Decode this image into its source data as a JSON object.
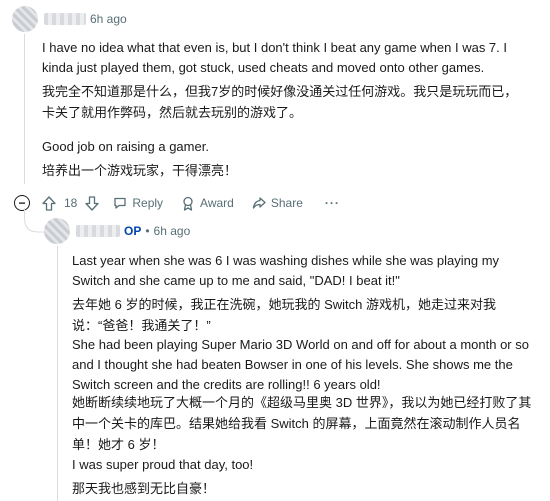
{
  "comment1": {
    "time": "6h ago",
    "en_paragraph1": "I have no idea what that even is, but I don't think I beat any game when I was 7. I kinda just played them, got stuck, used cheats and moved onto other games.",
    "zh_paragraph1": "我完全不知道那是什么，但我7岁的时候好像没通关过任何游戏。我只是玩玩而已，卡关了就用作弊码，然后就去玩别的游戏了。",
    "en_paragraph2": "Good job on raising a gamer.",
    "zh_paragraph2": "培养出一个游戏玩家，干得漂亮！",
    "actions": {
      "vote_count": "18",
      "reply_label": "Reply",
      "award_label": "Award",
      "share_label": "Share",
      "more_label": "···"
    }
  },
  "comment2": {
    "op_badge": "OP",
    "separator": "•",
    "time": "6h ago",
    "en_paragraph1": "Last year when she was 6 I was washing dishes while she was playing my Switch and she came up to me and said, \"DAD! I beat it!\"",
    "zh_paragraph1": "去年她 6 岁的时候，我正在洗碗，她玩我的 Switch 游戏机，她走过来对我说：“爸爸！我通关了！”",
    "en_paragraph2": "She had been playing Super Mario 3D World on and off for about a month or so and I thought she had beaten Bowser in one of his levels. She shows me the Switch screen and the credits are rolling!! 6 years old!",
    "zh_paragraph2": "她断断续续地玩了大概一个月的《超级马里奥 3D 世界》，我以为她已经打败了其中一个关卡的库巴。结果她给我看 Switch 的屏幕，上面竟然在滚动制作人员名单！她才 6 岁！",
    "en_paragraph3": "I was super proud that day, too!",
    "zh_paragraph3": "那天我也感到无比自豪！"
  },
  "collapse_symbol": "−"
}
